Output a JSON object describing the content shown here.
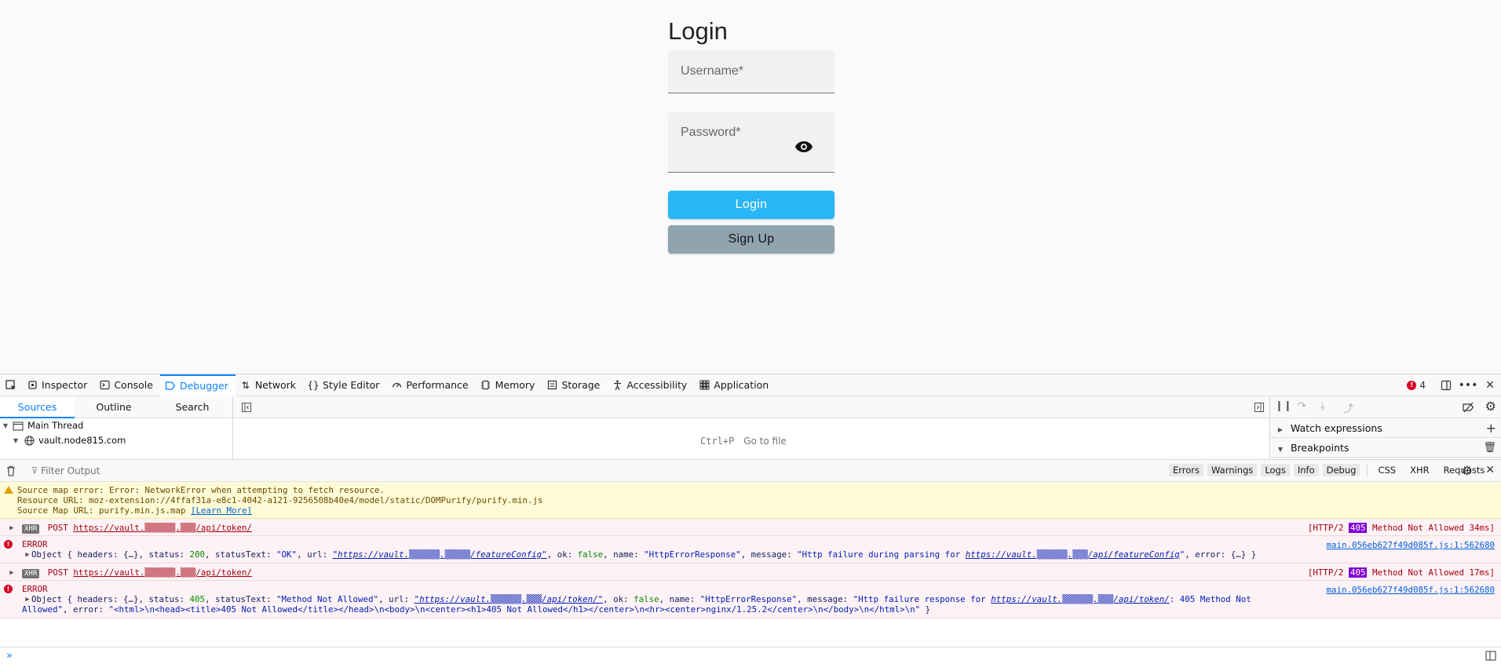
{
  "login": {
    "title": "Login",
    "username_label": "Username*",
    "password_label": "Password*",
    "login_button": "Login",
    "signup_button": "Sign Up"
  },
  "devtools": {
    "tabs": [
      {
        "label": "Inspector",
        "icon": "inspector-icon"
      },
      {
        "label": "Console",
        "icon": "console-icon"
      },
      {
        "label": "Debugger",
        "icon": "debugger-icon",
        "active": true
      },
      {
        "label": "Network",
        "icon": "network-icon"
      },
      {
        "label": "Style Editor",
        "icon": "style-editor-icon"
      },
      {
        "label": "Performance",
        "icon": "performance-icon"
      },
      {
        "label": "Memory",
        "icon": "memory-icon"
      },
      {
        "label": "Storage",
        "icon": "storage-icon"
      },
      {
        "label": "Accessibility",
        "icon": "accessibility-icon"
      },
      {
        "label": "Application",
        "icon": "application-icon"
      }
    ],
    "error_count": "4",
    "sources_tabs": [
      "Sources",
      "Outline",
      "Search"
    ],
    "tree": {
      "main_thread": "Main Thread",
      "domain": "vault.node815.com"
    },
    "goto": {
      "shortcut": "Ctrl+P",
      "label": "Go to file"
    },
    "right_pane": {
      "watch": "Watch expressions",
      "breakpoints": "Breakpoints"
    },
    "console": {
      "filter_placeholder": "Filter Output",
      "filters": [
        "Errors",
        "Warnings",
        "Logs",
        "Info",
        "Debug"
      ],
      "filters_plain": [
        "CSS",
        "XHR",
        "Requests"
      ],
      "warning": {
        "line1": "Source map error: Error: NetworkError when attempting to fetch resource.",
        "line2": "Resource URL: moz-extension://4ffaf31a-e8c1-4042-a121-9256508b40e4/model/static/DOMPurify/purify.min.js",
        "line3": "Source Map URL: purify.min.js.map",
        "learn_more": "[Learn More]"
      },
      "xhr1": {
        "badge": "XHR",
        "method": "POST",
        "url": "https://vault.▒▒▒▒▒▒.▒▒▒/api/token/",
        "status_prefix": "[HTTP/2",
        "status_code": "405",
        "status_suffix": "Method Not Allowed 34ms]"
      },
      "error1": {
        "label": "ERROR",
        "location": "main.056eb627f49d085f.js:1:562680",
        "body_a": "Object { headers: {…}, status: ",
        "status": "200",
        "body_b": ", statusText: ",
        "status_text": "\"OK\"",
        "body_c": ", url: ",
        "url": "\"https://vault.▒▒▒▒▒▒.▒▒▒▒▒/featureConfig\"",
        "body_d": ", ok: ",
        "ok": "false",
        "body_e": ", name: ",
        "name": "\"HttpErrorResponse\"",
        "body_f": ", message: ",
        "message": "\"Http failure during parsing for ",
        "message_url": "https://vault.▒▒▒▒▒▒.▒▒▒/api/featureConfig",
        "message_end": "\"",
        "body_g": ", error: {…} }"
      },
      "xhr2": {
        "badge": "XHR",
        "method": "POST",
        "url": "https://vault.▒▒▒▒▒▒.▒▒▒/api/token/",
        "status_prefix": "[HTTP/2",
        "status_code": "405",
        "status_suffix": "Method Not Allowed 17ms]"
      },
      "error2": {
        "label": "ERROR",
        "location": "main.056eb627f49d085f.js:1:562680",
        "body_a": "Object { headers: {…}, status: ",
        "status": "405",
        "body_b": ", statusText: ",
        "status_text": "\"Method Not Allowed\"",
        "body_c": ", url: ",
        "url": "\"https://vault.▒▒▒▒▒▒.▒▒▒/api/token/\"",
        "body_d": ", ok: ",
        "ok": "false",
        "body_e": ", name: ",
        "name": "\"HttpErrorResponse\"",
        "body_f": ", message: ",
        "message": "\"Http failure response for ",
        "message_url": "https://vault.▒▒▒▒▒▒.▒▒▒/api/token/",
        "message_end": ": 405 Method Not",
        "line2_a": "Allowed\"",
        "line2_b": ", error: ",
        "line2_c": "\"<html>\\n<head><title>405 Not Allowed</title></head>\\n<body>\\n<center><h1>405 Not Allowed</h1></center>\\n<hr><center>nginx/1.25.2</center>\\n</body>\\n</html>\\n\"",
        "line2_d": " }"
      }
    }
  },
  "colors": {
    "accent": "#0a84ff",
    "login_button": "#29b6f6",
    "signup_button": "#90a4ae",
    "error": "#d70022",
    "status_badge": "#8000d7"
  }
}
